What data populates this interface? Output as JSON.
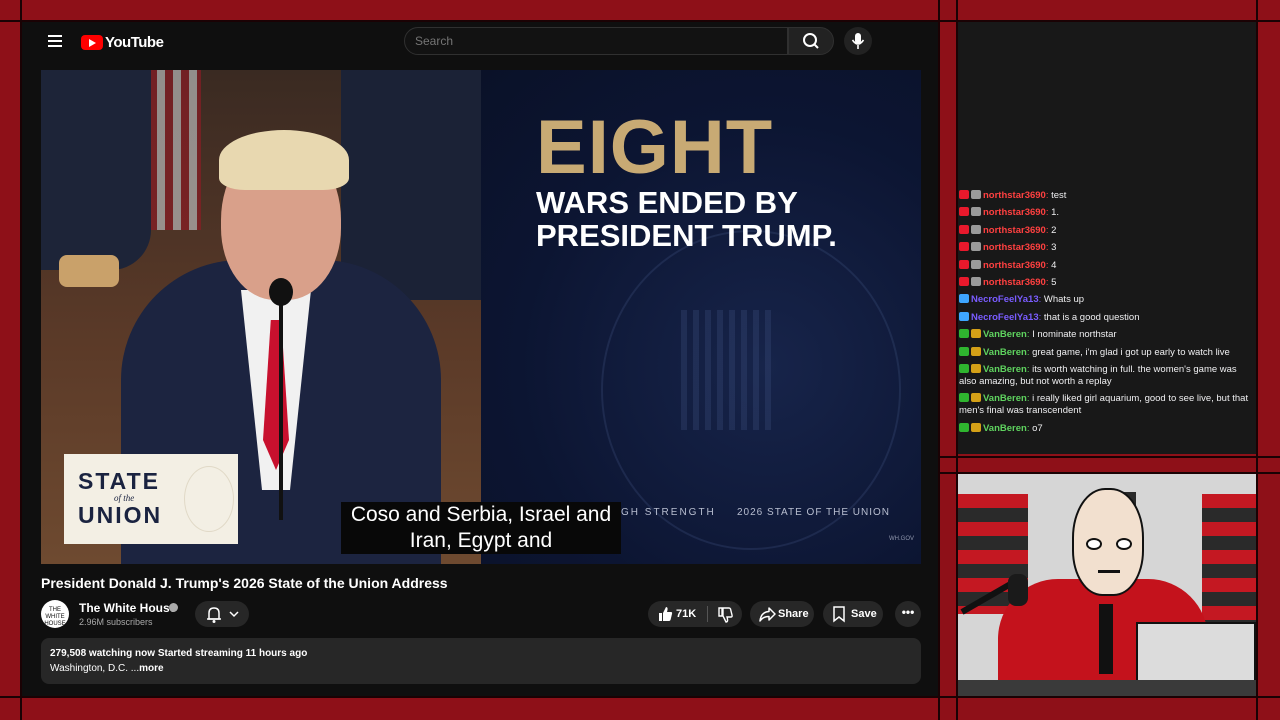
{
  "youtube": {
    "logo_text": "YouTube",
    "search_placeholder": "Search",
    "video": {
      "overlay_eight": "EIGHT",
      "overlay_line2": "WARS ENDED BY",
      "overlay_line3": "PRESIDENT TRUMP.",
      "lower_left_text": "GH STRENGTH",
      "lower_right_text": "2026 STATE OF THE UNION",
      "watermark": "WH.GOV",
      "badge_line1": "STATE",
      "badge_line2": "of the",
      "badge_line3": "UNION",
      "caption_line1": "Coso and Serbia, Israel and",
      "caption_line2": "Iran, Egypt and"
    },
    "title": "President Donald J. Trump's 2026 State of the Union Address",
    "channel": {
      "avatar_text": "THE WHITE HOUSE",
      "name": "The White House",
      "subscribers": "2.96M subscribers"
    },
    "actions": {
      "likes": "71K",
      "share": "Share",
      "save": "Save",
      "more": "•••"
    },
    "description": {
      "stats": "279,508 watching now  Started streaming 11 hours ago",
      "location": "Washington, D.C. ...",
      "more": "more"
    }
  },
  "chat": {
    "messages": [
      {
        "user": "northstar3690",
        "text": "test",
        "user_color": "#ff4040",
        "badges": [
          "#e8192c",
          "#9a9a9a"
        ]
      },
      {
        "user": "northstar3690",
        "text": "1.",
        "user_color": "#ff4040",
        "badges": [
          "#e8192c",
          "#9a9a9a"
        ]
      },
      {
        "user": "northstar3690",
        "text": "2",
        "user_color": "#ff4040",
        "badges": [
          "#e8192c",
          "#9a9a9a"
        ]
      },
      {
        "user": "northstar3690",
        "text": "3",
        "user_color": "#ff4040",
        "badges": [
          "#e8192c",
          "#9a9a9a"
        ]
      },
      {
        "user": "northstar3690",
        "text": "4",
        "user_color": "#ff4040",
        "badges": [
          "#e8192c",
          "#9a9a9a"
        ]
      },
      {
        "user": "northstar3690",
        "text": "5",
        "user_color": "#ff4040",
        "badges": [
          "#e8192c",
          "#9a9a9a"
        ]
      },
      {
        "user": "NecroFeelYa13",
        "text": "Whats up",
        "user_color": "#7a5cff",
        "badges": [
          "#3ea6ff"
        ]
      },
      {
        "user": "NecroFeelYa13",
        "text": "that is a good question",
        "user_color": "#7a5cff",
        "badges": [
          "#3ea6ff"
        ]
      },
      {
        "user": "VanBeren",
        "text": "I nominate northstar",
        "user_color": "#5fd35f",
        "badges": [
          "#2fb52f",
          "#d4a017"
        ]
      },
      {
        "user": "VanBeren",
        "text": "great game, i'm glad i got up early to watch live",
        "user_color": "#5fd35f",
        "badges": [
          "#2fb52f",
          "#d4a017"
        ]
      },
      {
        "user": "VanBeren",
        "text": "its worth watching in full. the women's game was also amazing, but not worth a replay",
        "user_color": "#5fd35f",
        "badges": [
          "#2fb52f",
          "#d4a017"
        ]
      },
      {
        "user": "VanBeren",
        "text": "i really liked girl aquarium, good to see live, but that men's final was transcendent",
        "user_color": "#5fd35f",
        "badges": [
          "#2fb52f",
          "#d4a017"
        ]
      },
      {
        "user": "VanBeren",
        "text": "o7",
        "user_color": "#5fd35f",
        "badges": [
          "#2fb52f",
          "#d4a017"
        ]
      }
    ]
  },
  "colors": {
    "frame": "#8e1018",
    "youtube_bg": "#0f0f0f",
    "accent_gold": "#c8aa74",
    "youtube_red": "#ff0000"
  }
}
